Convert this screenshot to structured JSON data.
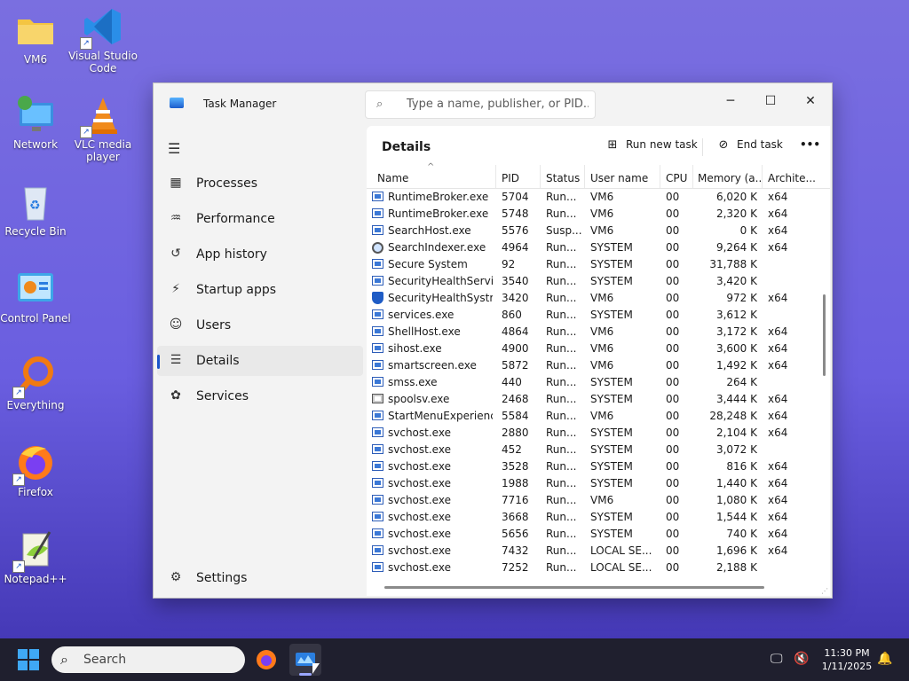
{
  "desktop": {
    "icons": [
      {
        "label": "VM6",
        "icon": "folder-icon"
      },
      {
        "label": "Visual Studio Code",
        "icon": "vscode-icon"
      },
      {
        "label": "Network",
        "icon": "network-icon"
      },
      {
        "label": "VLC media player",
        "icon": "vlc-icon"
      },
      {
        "label": "Recycle Bin",
        "icon": "recycle-bin-icon"
      },
      {
        "label": "Control Panel",
        "icon": "control-panel-icon"
      },
      {
        "label": "Everything",
        "icon": "everything-icon"
      },
      {
        "label": "Firefox",
        "icon": "firefox-icon"
      },
      {
        "label": "Notepad++",
        "icon": "notepadpp-icon"
      }
    ]
  },
  "window": {
    "title": "Task Manager",
    "search_placeholder": "Type a name, publisher, or PID...",
    "controls": {
      "minimize": "─",
      "maximize": "☐",
      "close": "✕"
    }
  },
  "sidebar": {
    "items": [
      {
        "label": "Processes",
        "icon": "processes-icon",
        "glyph": "▦"
      },
      {
        "label": "Performance",
        "icon": "performance-icon",
        "glyph": "♒"
      },
      {
        "label": "App history",
        "icon": "app-history-icon",
        "glyph": "↺"
      },
      {
        "label": "Startup apps",
        "icon": "startup-apps-icon",
        "glyph": "⚡"
      },
      {
        "label": "Users",
        "icon": "users-icon",
        "glyph": "☺"
      },
      {
        "label": "Details",
        "icon": "details-icon",
        "glyph": "☰"
      },
      {
        "label": "Services",
        "icon": "services-icon",
        "glyph": "✿"
      }
    ],
    "active": "Details",
    "settings_label": "Settings"
  },
  "details": {
    "title": "Details",
    "run_new_task": "Run new task",
    "end_task": "End task",
    "more": "•••",
    "columns": [
      "Name",
      "PID",
      "Status",
      "User name",
      "CPU",
      "Memory (a...",
      "Archite..."
    ],
    "rows": [
      {
        "name": "RuntimeBroker.exe",
        "pid": "5704",
        "status": "Run...",
        "user": "VM6",
        "cpu": "00",
        "mem": "6,020 K",
        "arch": "x64",
        "icon": "app"
      },
      {
        "name": "RuntimeBroker.exe",
        "pid": "5748",
        "status": "Run...",
        "user": "VM6",
        "cpu": "00",
        "mem": "2,320 K",
        "arch": "x64",
        "icon": "app"
      },
      {
        "name": "SearchHost.exe",
        "pid": "5576",
        "status": "Susp...",
        "user": "VM6",
        "cpu": "00",
        "mem": "0 K",
        "arch": "x64",
        "icon": "app"
      },
      {
        "name": "SearchIndexer.exe",
        "pid": "4964",
        "status": "Run...",
        "user": "SYSTEM",
        "cpu": "00",
        "mem": "9,264 K",
        "arch": "x64",
        "icon": "search"
      },
      {
        "name": "Secure System",
        "pid": "92",
        "status": "Run...",
        "user": "SYSTEM",
        "cpu": "00",
        "mem": "31,788 K",
        "arch": "",
        "icon": "app"
      },
      {
        "name": "SecurityHealthServic...",
        "pid": "3540",
        "status": "Run...",
        "user": "SYSTEM",
        "cpu": "00",
        "mem": "3,420 K",
        "arch": "",
        "icon": "app"
      },
      {
        "name": "SecurityHealthSystra...",
        "pid": "3420",
        "status": "Run...",
        "user": "VM6",
        "cpu": "00",
        "mem": "972 K",
        "arch": "x64",
        "icon": "shield"
      },
      {
        "name": "services.exe",
        "pid": "860",
        "status": "Run...",
        "user": "SYSTEM",
        "cpu": "00",
        "mem": "3,612 K",
        "arch": "",
        "icon": "app"
      },
      {
        "name": "ShellHost.exe",
        "pid": "4864",
        "status": "Run...",
        "user": "VM6",
        "cpu": "00",
        "mem": "3,172 K",
        "arch": "x64",
        "icon": "app"
      },
      {
        "name": "sihost.exe",
        "pid": "4900",
        "status": "Run...",
        "user": "VM6",
        "cpu": "00",
        "mem": "3,600 K",
        "arch": "x64",
        "icon": "app"
      },
      {
        "name": "smartscreen.exe",
        "pid": "5872",
        "status": "Run...",
        "user": "VM6",
        "cpu": "00",
        "mem": "1,492 K",
        "arch": "x64",
        "icon": "app"
      },
      {
        "name": "smss.exe",
        "pid": "440",
        "status": "Run...",
        "user": "SYSTEM",
        "cpu": "00",
        "mem": "264 K",
        "arch": "",
        "icon": "app"
      },
      {
        "name": "spoolsv.exe",
        "pid": "2468",
        "status": "Run...",
        "user": "SYSTEM",
        "cpu": "00",
        "mem": "3,444 K",
        "arch": "x64",
        "icon": "printer"
      },
      {
        "name": "StartMenuExperienc...",
        "pid": "5584",
        "status": "Run...",
        "user": "VM6",
        "cpu": "00",
        "mem": "28,248 K",
        "arch": "x64",
        "icon": "app"
      },
      {
        "name": "svchost.exe",
        "pid": "2880",
        "status": "Run...",
        "user": "SYSTEM",
        "cpu": "00",
        "mem": "2,104 K",
        "arch": "x64",
        "icon": "app"
      },
      {
        "name": "svchost.exe",
        "pid": "452",
        "status": "Run...",
        "user": "SYSTEM",
        "cpu": "00",
        "mem": "3,072 K",
        "arch": "",
        "icon": "app"
      },
      {
        "name": "svchost.exe",
        "pid": "3528",
        "status": "Run...",
        "user": "SYSTEM",
        "cpu": "00",
        "mem": "816 K",
        "arch": "x64",
        "icon": "app"
      },
      {
        "name": "svchost.exe",
        "pid": "1988",
        "status": "Run...",
        "user": "SYSTEM",
        "cpu": "00",
        "mem": "1,440 K",
        "arch": "x64",
        "icon": "app"
      },
      {
        "name": "svchost.exe",
        "pid": "7716",
        "status": "Run...",
        "user": "VM6",
        "cpu": "00",
        "mem": "1,080 K",
        "arch": "x64",
        "icon": "app"
      },
      {
        "name": "svchost.exe",
        "pid": "3668",
        "status": "Run...",
        "user": "SYSTEM",
        "cpu": "00",
        "mem": "1,544 K",
        "arch": "x64",
        "icon": "app"
      },
      {
        "name": "svchost.exe",
        "pid": "5656",
        "status": "Run...",
        "user": "SYSTEM",
        "cpu": "00",
        "mem": "740 K",
        "arch": "x64",
        "icon": "app"
      },
      {
        "name": "svchost.exe",
        "pid": "7432",
        "status": "Run...",
        "user": "LOCAL SE...",
        "cpu": "00",
        "mem": "1,696 K",
        "arch": "x64",
        "icon": "app"
      },
      {
        "name": "svchost.exe",
        "pid": "7252",
        "status": "Run...",
        "user": "LOCAL SE...",
        "cpu": "00",
        "mem": "2,188 K",
        "arch": "",
        "icon": "app"
      }
    ]
  },
  "taskbar": {
    "search_label": "Search",
    "time": "11:30 PM",
    "date": "1/11/2025"
  },
  "colors": {
    "accent": "#1a56c9",
    "desktop_top": "#7a6fe0",
    "taskbar": "#1f1f2e"
  }
}
